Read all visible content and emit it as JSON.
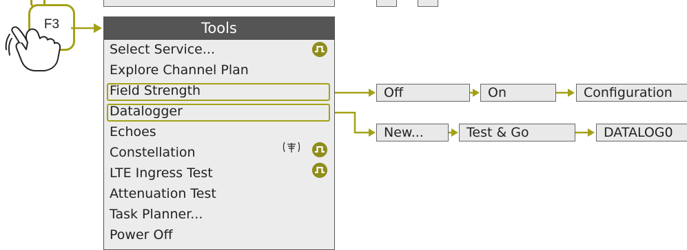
{
  "key": {
    "label": "F3"
  },
  "menu": {
    "title": "Tools",
    "items": [
      {
        "label": "Select Service..."
      },
      {
        "label": "Explore Channel Plan"
      },
      {
        "label": "Field Strength"
      },
      {
        "label": "Datalogger"
      },
      {
        "label": "Echoes"
      },
      {
        "label": "Constellation"
      },
      {
        "label": "LTE Ingress Test"
      },
      {
        "label": "Attenuation Test"
      },
      {
        "label": "Task Planner..."
      },
      {
        "label": "Power Off"
      }
    ]
  },
  "field_strength_flow": {
    "step1": "Off",
    "step2": "On",
    "step3": "Configuration"
  },
  "datalogger_flow": {
    "step1": "New...",
    "step2": "Test & Go",
    "step3": "DATALOG0"
  },
  "icons": {
    "signal": "signal-pulse-icon",
    "antenna": "antenna-icon",
    "hand": "hand-pointer-icon",
    "arrow": "arrow-right-icon"
  },
  "colors": {
    "accent": "#a3a117",
    "icon_fill": "#8e8d1d",
    "header_bg": "#555555",
    "menu_bg": "#ececec"
  }
}
